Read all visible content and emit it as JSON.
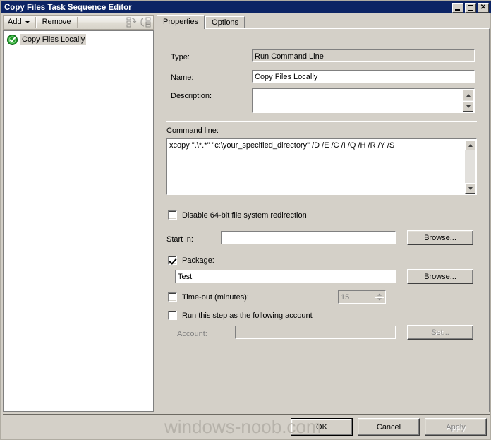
{
  "window": {
    "title": "Copy Files Task Sequence Editor",
    "controls": {
      "minimize": "_",
      "maximize": "□",
      "close": "✕"
    }
  },
  "toolbar": {
    "add_label": "Add",
    "remove_label": "Remove",
    "icons": [
      {
        "name": "collapse-all-icon"
      },
      {
        "name": "expand-all-icon"
      }
    ]
  },
  "tree": {
    "items": [
      {
        "label": "Copy Files Locally",
        "icon": "green-check-circle-icon",
        "selected": true
      }
    ]
  },
  "tabs": [
    {
      "label": "Properties",
      "active": true
    },
    {
      "label": "Options",
      "active": false
    }
  ],
  "properties": {
    "type_label": "Type:",
    "type_value": "Run Command Line",
    "name_label": "Name:",
    "name_value": "Copy Files Locally",
    "description_label": "Description:",
    "description_value": "",
    "command_line_label": "Command line:",
    "command_line_value": "xcopy \".\\*.*\" \"c:\\your_specified_directory\" /D /E /C /I /Q /H /R /Y /S",
    "disable_redirection_label": "Disable 64-bit file system redirection",
    "disable_redirection_checked": false,
    "start_in_label": "Start in:",
    "start_in_value": "",
    "start_in_browse_label": "Browse...",
    "package_label": "Package:",
    "package_checked": true,
    "package_value": "Test",
    "package_browse_label": "Browse...",
    "timeout_label": "Time-out (minutes):",
    "timeout_checked": false,
    "timeout_value": "15",
    "run_as_label": "Run this step as the following account",
    "run_as_checked": false,
    "account_label": "Account:",
    "account_value": "",
    "account_set_label": "Set..."
  },
  "footer": {
    "ok_label": "OK",
    "cancel_label": "Cancel",
    "apply_label": "Apply",
    "apply_disabled": true
  },
  "watermark": {
    "text": "windows-noob.com"
  },
  "colors": {
    "titlebar": "#0c2464",
    "face": "#d4d0c8",
    "field": "#ffffff",
    "accent_green": "#1f9b29"
  }
}
